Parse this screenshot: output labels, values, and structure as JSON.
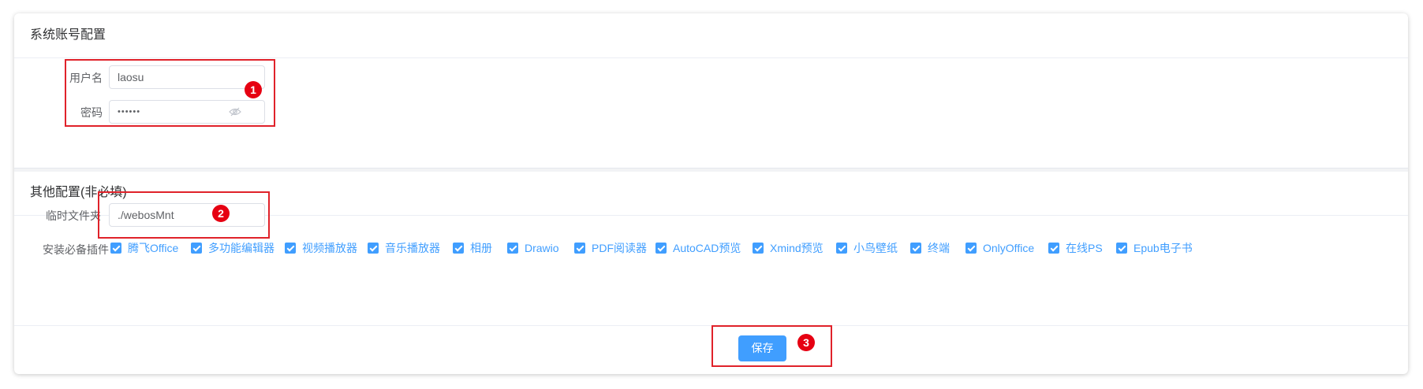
{
  "sections": {
    "system": {
      "title": "系统账号配置"
    },
    "other": {
      "title": "其他配置(非必填)"
    }
  },
  "form": {
    "username": {
      "label": "用户名",
      "value": "laosu"
    },
    "password": {
      "label": "密码",
      "value": "••••••",
      "icon": "eye-hidden-icon"
    },
    "temp_folder": {
      "label": "临时文件夹",
      "value": "./webosMnt"
    },
    "plugins": {
      "label": "安装必备插件",
      "items": [
        {
          "label": "腾飞Office",
          "checked": true
        },
        {
          "label": "多功能编辑器",
          "checked": true
        },
        {
          "label": "视频播放器",
          "checked": true
        },
        {
          "label": "音乐播放器",
          "checked": true
        },
        {
          "label": "相册",
          "checked": true
        },
        {
          "label": "Drawio",
          "checked": true
        },
        {
          "label": "PDF阅读器",
          "checked": true
        },
        {
          "label": "AutoCAD预览",
          "checked": true
        },
        {
          "label": "Xmind预览",
          "checked": true
        },
        {
          "label": "小鸟壁纸",
          "checked": true
        },
        {
          "label": "终端",
          "checked": true
        },
        {
          "label": "OnlyOffice",
          "checked": true
        },
        {
          "label": "在线PS",
          "checked": true
        },
        {
          "label": "Epub电子书",
          "checked": true
        }
      ]
    }
  },
  "actions": {
    "save_label": "保存"
  },
  "annotations": {
    "m1": "1",
    "m2": "2",
    "m3": "3"
  },
  "colors": {
    "accent": "#409eff",
    "annotation_red": "#e0222a"
  }
}
